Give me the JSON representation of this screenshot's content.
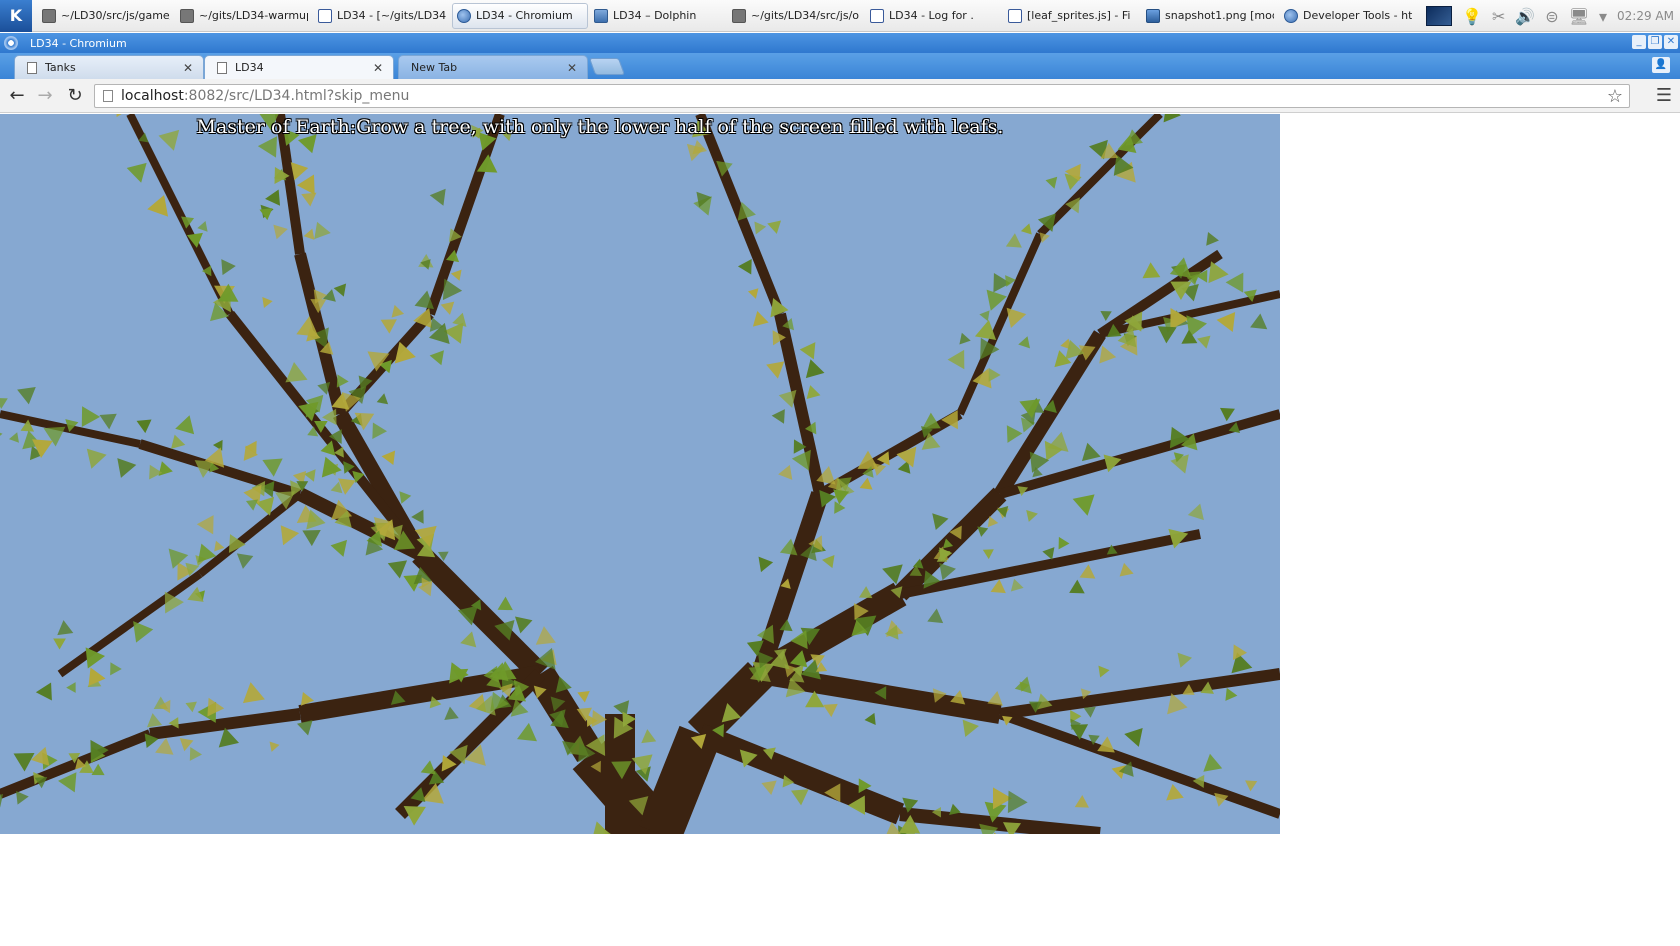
{
  "taskbar": {
    "tasks": [
      {
        "label": "~/LD30/src/js/game/",
        "icon": "terminal-icon"
      },
      {
        "label": "~/gits/LD34-warmup",
        "icon": "terminal-icon"
      },
      {
        "label": "LD34 - [~/gits/LD34",
        "icon": "kate-icon"
      },
      {
        "label": "LD34 - Chromium",
        "icon": "chromium-icon"
      },
      {
        "label": "LD34 – Dolphin",
        "icon": "dolphin-icon"
      },
      {
        "label": "~/gits/LD34/src/js/o",
        "icon": "terminal-icon"
      },
      {
        "label": "LD34 - Log for .",
        "icon": "kate-icon"
      },
      {
        "label": "[leaf_sprites.js] - Fi",
        "icon": "kate-icon"
      },
      {
        "label": "snapshot1.png [mod",
        "icon": "image-icon"
      },
      {
        "label": "Developer Tools - ht",
        "icon": "chromium-icon"
      }
    ],
    "clock": "02:29 AM"
  },
  "window": {
    "title": "LD34 - Chromium"
  },
  "tabs": [
    {
      "label": "Tanks"
    },
    {
      "label": "LD34"
    },
    {
      "label": "New Tab"
    }
  ],
  "omnibox": {
    "host": "localhost",
    "rest": ":8082/src/LD34.html?skip_menu"
  },
  "game": {
    "objective": "Master of Earth:Grow a tree, with only the lower half of the screen filled with leafs.",
    "colors": {
      "sky": "#86a8d1",
      "branch": "#3b2311",
      "leaf_green": "#6f9a2a",
      "leaf_yellow": "#b3a83a"
    }
  }
}
